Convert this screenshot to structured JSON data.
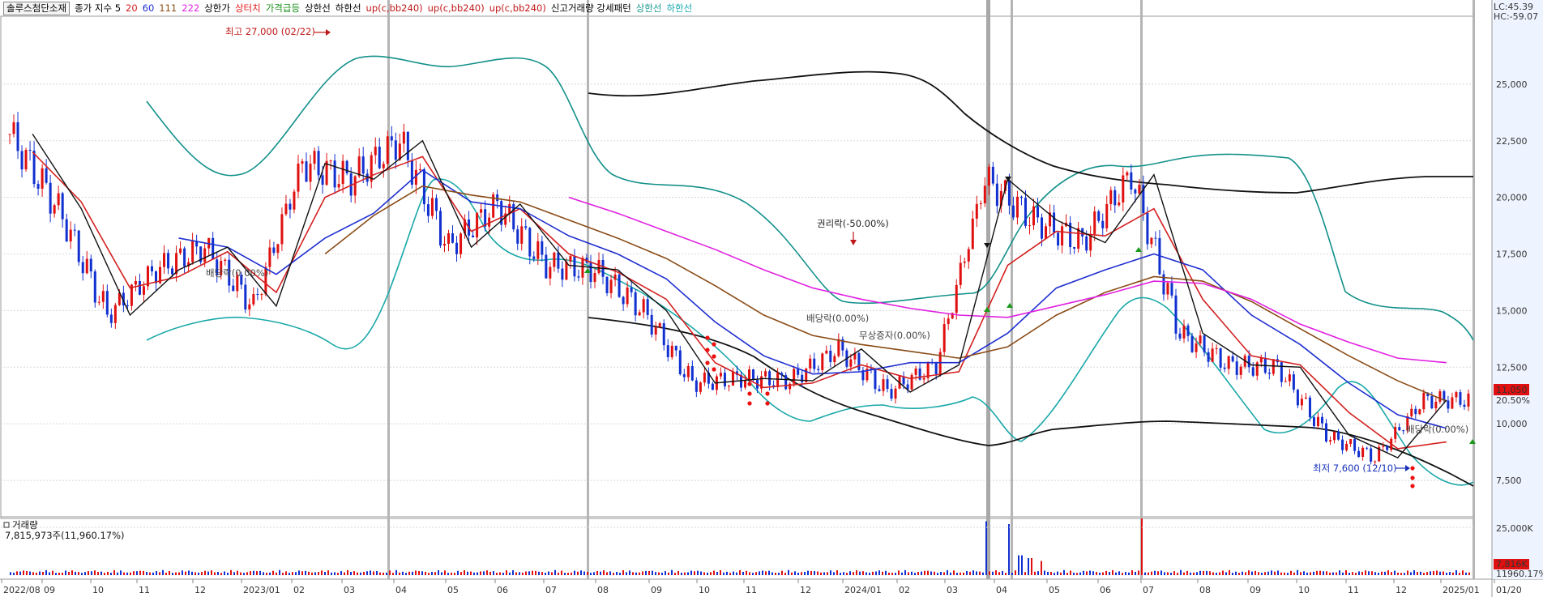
{
  "header": {
    "stock_name": "솔루스첨단소재",
    "label_price_ma": "종가 지수 5",
    "ma_periods": [
      {
        "label": "20",
        "color": "#d42020"
      },
      {
        "label": "60",
        "color": "#1f2fd0"
      },
      {
        "label": "111",
        "color": "#8a4b16"
      },
      {
        "label": "222",
        "color": "#e020e0"
      }
    ],
    "label_upper_limit": "상한가",
    "label_upper_touch": "상터치",
    "label_price_surge": "가격급등",
    "label_upper_line": "상한선",
    "label_lower_line": "하한선",
    "bb_labels": [
      "up(c,bb240)",
      "up(c,bb240)",
      "up(c,bb240)"
    ],
    "label_pattern": "신고거래량 강세패턴",
    "label_upper_line2": "상한선",
    "label_lower_line2": "하한선",
    "lc": "LC:45.39",
    "hc": "HC:-59.07"
  },
  "annotations": {
    "high": "최고 27,000 (02/22)",
    "low": "최저 7,600 (12/10)",
    "rights": "권리락(-50.00%)",
    "dividend_1": "배당락(0.00%)",
    "dividend_2": "배당락(0.00%)",
    "dividend_3": "무상증자(0.00%)",
    "dividend_4": "배당락(0.00%)"
  },
  "price_axis": {
    "ticks": [
      "25,000",
      "22,500",
      "20,000",
      "17,500",
      "15,000",
      "12,500",
      "10,000",
      "7,500"
    ],
    "last_price": "11,050",
    "last_change": "20.50%"
  },
  "volume_panel": {
    "title": "거래량",
    "value": "7,815,973주(11,960.17%)",
    "ticks": [
      "25,000K"
    ],
    "last_volume": "7,816K",
    "last_change": "11960.17%"
  },
  "x_axis": {
    "labels": [
      "2022/08",
      "09",
      "10",
      "11",
      "12",
      "2023/01",
      "02",
      "03",
      "04",
      "05",
      "06",
      "07",
      "08",
      "09",
      "10",
      "11",
      "12",
      "2024/01",
      "02",
      "03",
      "04",
      "05",
      "06",
      "07",
      "08",
      "09",
      "10",
      "11",
      "12",
      "2025/01",
      "01/20"
    ]
  },
  "chart_data": {
    "type": "candlestick",
    "y_range": [
      6000,
      28000
    ],
    "x": [
      "2022/08",
      "2022/09",
      "2022/10",
      "2022/11",
      "2022/12",
      "2023/01",
      "2023/02",
      "2023/03",
      "2023/04",
      "2023/05",
      "2023/06",
      "2023/07",
      "2023/08",
      "2023/09",
      "2023/10",
      "2023/11",
      "2023/12",
      "2024/01",
      "2024/02",
      "2024/03",
      "2024/04",
      "2024/05",
      "2024/06",
      "2024/07",
      "2024/08",
      "2024/09",
      "2024/10",
      "2024/11",
      "2024/12",
      "2025/01"
    ],
    "close": [
      22800,
      19500,
      14800,
      16800,
      17800,
      15200,
      21500,
      20800,
      22500,
      17800,
      19700,
      17000,
      16800,
      15000,
      11800,
      12000,
      11900,
      13300,
      11400,
      12600,
      20800,
      19000,
      18000,
      21000,
      14000,
      12600,
      12500,
      9500,
      8500,
      11050
    ],
    "series": [
      {
        "name": "20",
        "values": [
          22000,
          19800,
          16000,
          16500,
          17600,
          15800,
          20000,
          21000,
          21800,
          18500,
          19500,
          17500,
          16700,
          15500,
          12700,
          11600,
          11800,
          12600,
          12000,
          12300,
          17000,
          18500,
          18300,
          19500,
          15500,
          13000,
          12600,
          10500,
          8900,
          9200
        ]
      },
      {
        "name": "60",
        "values": [
          null,
          null,
          null,
          18200,
          17800,
          16600,
          18200,
          19300,
          21200,
          19800,
          19500,
          18300,
          17500,
          16400,
          14500,
          13000,
          12200,
          12300,
          12700,
          12700,
          14000,
          16000,
          16800,
          17500,
          16800,
          14800,
          13500,
          11800,
          10400,
          9800
        ]
      },
      {
        "name": "111",
        "values": [
          null,
          null,
          null,
          null,
          null,
          null,
          17500,
          19200,
          20500,
          20100,
          19800,
          19000,
          18200,
          17300,
          16100,
          14800,
          13900,
          13500,
          13200,
          12900,
          13400,
          14800,
          15800,
          16500,
          16300,
          15400,
          14200,
          13000,
          11900,
          11000
        ]
      },
      {
        "name": "222",
        "values": [
          null,
          null,
          null,
          null,
          null,
          null,
          null,
          null,
          null,
          null,
          null,
          20000,
          19300,
          18500,
          17700,
          16800,
          16000,
          15500,
          15100,
          14800,
          14700,
          15200,
          15700,
          16300,
          16200,
          15500,
          14400,
          13600,
          12900,
          12700
        ]
      }
    ],
    "volume_max": 25000000,
    "volume_last": 7815973
  }
}
